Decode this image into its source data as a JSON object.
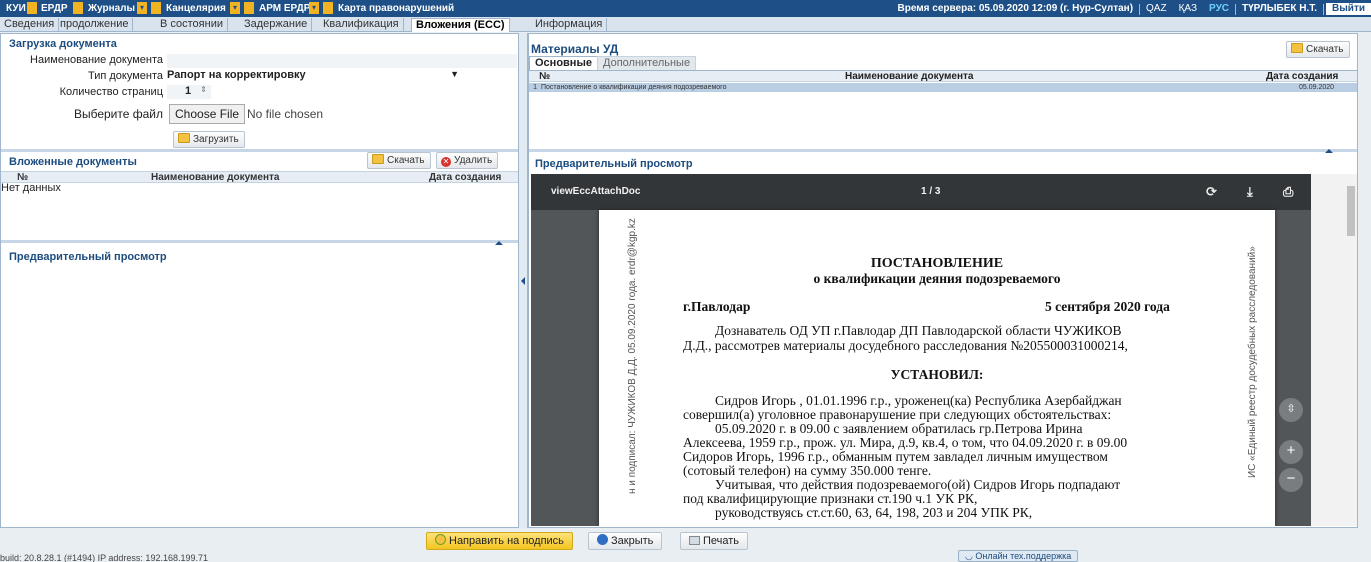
{
  "topbar": {
    "menu": [
      "КУИ",
      "ЕРДР",
      "Журналы",
      "Канцелярия",
      "АРМ ЕРДР",
      "Карта правонарушений"
    ],
    "server_time": "Время сервера: 05.09.2020 12:09 (г. Нур-Султан)",
    "lang_qaz": "QAZ",
    "lang_kaz": "ҚАЗ",
    "lang_rus": "РУС",
    "user": "ТҮРЛЫБЕК Н.Т.",
    "exit": "Выйти"
  },
  "tabs": [
    "Сведения",
    "продолжение",
    "В состоянии",
    "Задержание",
    "Квалификация",
    "Вложения (ЕСС)",
    "Информация"
  ],
  "upload": {
    "title": "Загрузка документа",
    "name_label": "Наименование документа",
    "name_value": "",
    "type_label": "Тип документа",
    "type_value": "Рапорт на корректировку",
    "pages_label": "Количество страниц",
    "pages_value": "1",
    "file_label": "Выберите файл",
    "file_button": "Choose File",
    "file_status": "No file chosen",
    "upload_button": "Загрузить"
  },
  "attached": {
    "title": "Вложенные документы",
    "download_button": "Скачать",
    "delete_button": "Удалить",
    "col_no": "№",
    "col_name": "Наименование документа",
    "col_date": "Дата создания",
    "empty": "Нет данных"
  },
  "left_preview_title": "Предварительный просмотр",
  "materials": {
    "title": "Материалы УД",
    "download_button": "Скачать",
    "tab_main": "Основные",
    "tab_extra": "Дополнительные",
    "col_no": "№",
    "col_name": "Наименование документа",
    "col_date": "Дата создания",
    "rows": [
      {
        "no": "1",
        "name": "Постановление о квалификации деяния подозреваемого",
        "date": "05.09.2020"
      }
    ]
  },
  "right_preview_title": "Предварительный просмотр",
  "viewer": {
    "file": "viewEccAttachDoc",
    "page_counter": "1 / 3",
    "side_left": "н и подписал: ЧУЖИКОВ Д.Д. 05.09.2020 года. erdr@kgp.kz",
    "side_right": "ИС «Единый реестр досудебных расследований»"
  },
  "doc": {
    "title": "ПОСТАНОВЛЕНИЕ",
    "subtitle": "о квалификации деяния подозреваемого",
    "city": "г.Павлодар",
    "date": "5 сентября 2020 года",
    "p1a": "Дознаватель ОД УП г.Павлодар ДП Павлодарской области ЧУЖИКОВ",
    "p1b": "Д.Д., рассмотрев материалы досудебного расследования №205500031000214,",
    "established": "УСТАНОВИЛ:",
    "p2a": "Сидров Игорь , 01.01.1996 г.р., уроженец(ка)    Республика Азербайджан",
    "p2b": "совершил(а) уголовное правонарушение при следующих обстоятельствах:",
    "p3a": "05.09.2020  г.  в  09.00  с  заявлением  обратилась  гр.Петрова  Ирина",
    "p3b": "Алексеева, 1959 г.р., прож. ул. Мира, д.9, кв.4, о том, что 04.09.2020 г. в 09.00",
    "p3c": "Сидоров Игорь, 1996 г.р., обманным путем завладел личным имуществом",
    "p3d": "(сотовый телефон) на сумму 350.000 тенге.",
    "p4a": "Учитывая, что действия подозреваемого(ой) Сидров Игорь    подпадают",
    "p4b": "под квалифицирующие признаки ст.190 ч.1 УК РК,",
    "p5": "руководствуясь ст.ст.60, 63, 64, 198, 203 и 204 УПК РК,"
  },
  "bottom": {
    "sign_button": "Направить на подпись",
    "close_button": "Закрыть",
    "print_button": "Печать",
    "status": "build: 20.8.28.1 (#1494)   IP address: 192.168.199.71",
    "support": "Онлайн тех.поддержка"
  }
}
